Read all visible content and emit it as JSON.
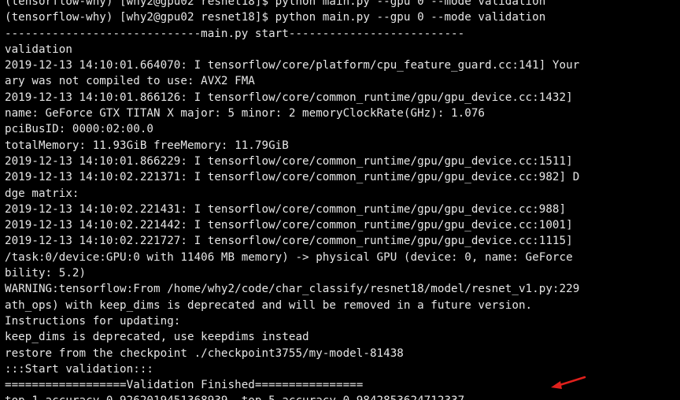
{
  "terminal": {
    "lines": [
      "(tensorflow-why) [why2@gpu02 resnet18]$ python main.py --gpu 0 --mode validation",
      "(tensorflow-why) [why2@gpu02 resnet18]$ python main.py --gpu 0 --mode validation",
      "-----------------------------main.py start--------------------------",
      "validation",
      "2019-12-13 14:10:01.664070: I tensorflow/core/platform/cpu_feature_guard.cc:141] Your",
      "ary was not compiled to use: AVX2 FMA",
      "2019-12-13 14:10:01.866126: I tensorflow/core/common_runtime/gpu/gpu_device.cc:1432]",
      "name: GeForce GTX TITAN X major: 5 minor: 2 memoryClockRate(GHz): 1.076",
      "pciBusID: 0000:02:00.0",
      "totalMemory: 11.93GiB freeMemory: 11.79GiB",
      "2019-12-13 14:10:01.866229: I tensorflow/core/common_runtime/gpu/gpu_device.cc:1511]",
      "2019-12-13 14:10:02.221371: I tensorflow/core/common_runtime/gpu/gpu_device.cc:982] D",
      "dge matrix:",
      "2019-12-13 14:10:02.221431: I tensorflow/core/common_runtime/gpu/gpu_device.cc:988]",
      "2019-12-13 14:10:02.221442: I tensorflow/core/common_runtime/gpu/gpu_device.cc:1001]",
      "2019-12-13 14:10:02.221727: I tensorflow/core/common_runtime/gpu/gpu_device.cc:1115]",
      "/task:0/device:GPU:0 with 11406 MB memory) -> physical GPU (device: 0, name: GeForce",
      "bility: 5.2)",
      "WARNING:tensorflow:From /home/why2/code/char_classify/resnet18/model/resnet_v1.py:229",
      "ath_ops) with keep_dims is deprecated and will be removed in a future version.",
      "Instructions for updating:",
      "keep_dims is deprecated, use keepdims instead",
      "restore from the checkpoint ./checkpoint3755/my-model-81438",
      ":::Start validation:::",
      "==================Validation Finished================",
      "top 1 accuracy 0.9262019451368939, top 5 accuracy 0.9842853624712337"
    ]
  },
  "colors": {
    "background": "#000000",
    "text": "#e6e6e6",
    "annotation_arrow": "#e0201c"
  }
}
